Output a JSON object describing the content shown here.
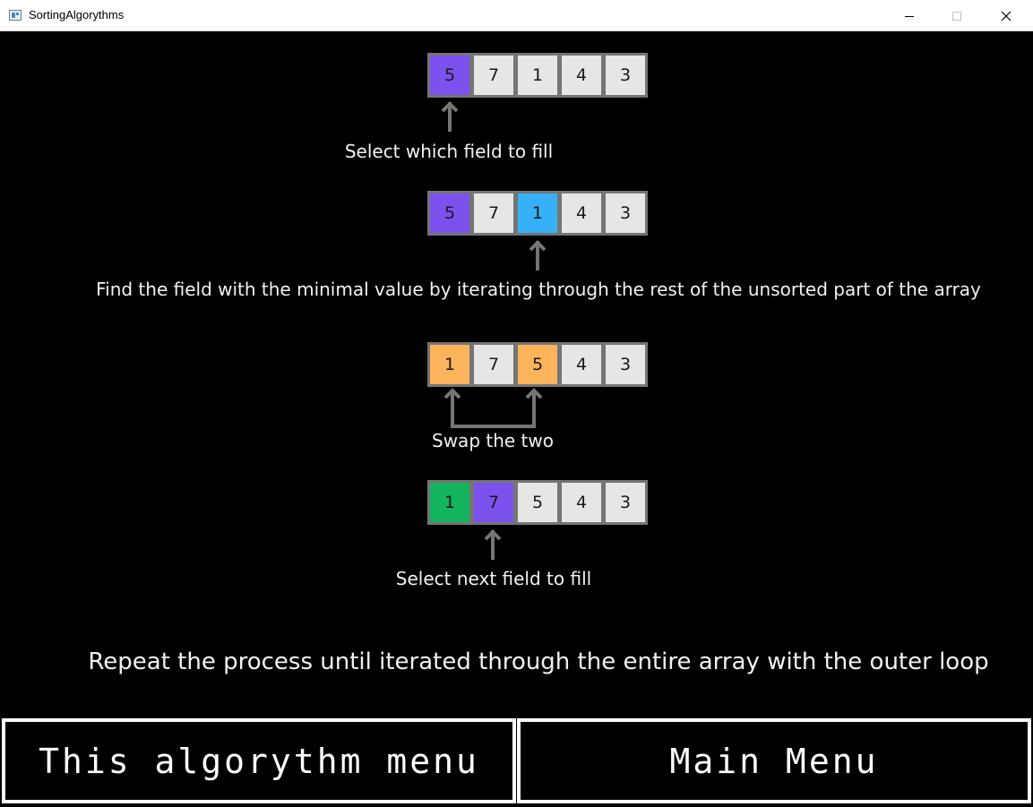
{
  "window": {
    "title": "SortingAlgorythms",
    "icons": [
      "app-window-icon",
      "minimize-icon",
      "maximize-icon",
      "close-icon"
    ]
  },
  "colors": {
    "selected": "#7b52ee",
    "minimum": "#36b1f7",
    "swap": "#fbb45c",
    "sorted": "#12b45d",
    "default": "#e6e6e4",
    "border": "#757575",
    "arrow": "#757575"
  },
  "steps": [
    {
      "cells": [
        {
          "value": "5",
          "state": "selected"
        },
        {
          "value": "7",
          "state": "default"
        },
        {
          "value": "1",
          "state": "default"
        },
        {
          "value": "4",
          "state": "default"
        },
        {
          "value": "3",
          "state": "default"
        }
      ],
      "caption": "Select which field to fill"
    },
    {
      "cells": [
        {
          "value": "5",
          "state": "selected"
        },
        {
          "value": "7",
          "state": "default"
        },
        {
          "value": "1",
          "state": "minimum"
        },
        {
          "value": "4",
          "state": "default"
        },
        {
          "value": "3",
          "state": "default"
        }
      ],
      "caption": "Find the field with the minimal value by iterating through the rest of the unsorted part of the array"
    },
    {
      "cells": [
        {
          "value": "1",
          "state": "swap"
        },
        {
          "value": "7",
          "state": "default"
        },
        {
          "value": "5",
          "state": "swap"
        },
        {
          "value": "4",
          "state": "default"
        },
        {
          "value": "3",
          "state": "default"
        }
      ],
      "caption": "Swap the two"
    },
    {
      "cells": [
        {
          "value": "1",
          "state": "sorted"
        },
        {
          "value": "7",
          "state": "selected"
        },
        {
          "value": "5",
          "state": "default"
        },
        {
          "value": "4",
          "state": "default"
        },
        {
          "value": "3",
          "state": "default"
        }
      ],
      "caption": "Select next field to fill"
    }
  ],
  "footer_note": "Repeat the process until iterated through the entire array with the outer loop",
  "buttons": {
    "algorithm_menu": "This algorythm menu",
    "main_menu": "Main Menu"
  }
}
